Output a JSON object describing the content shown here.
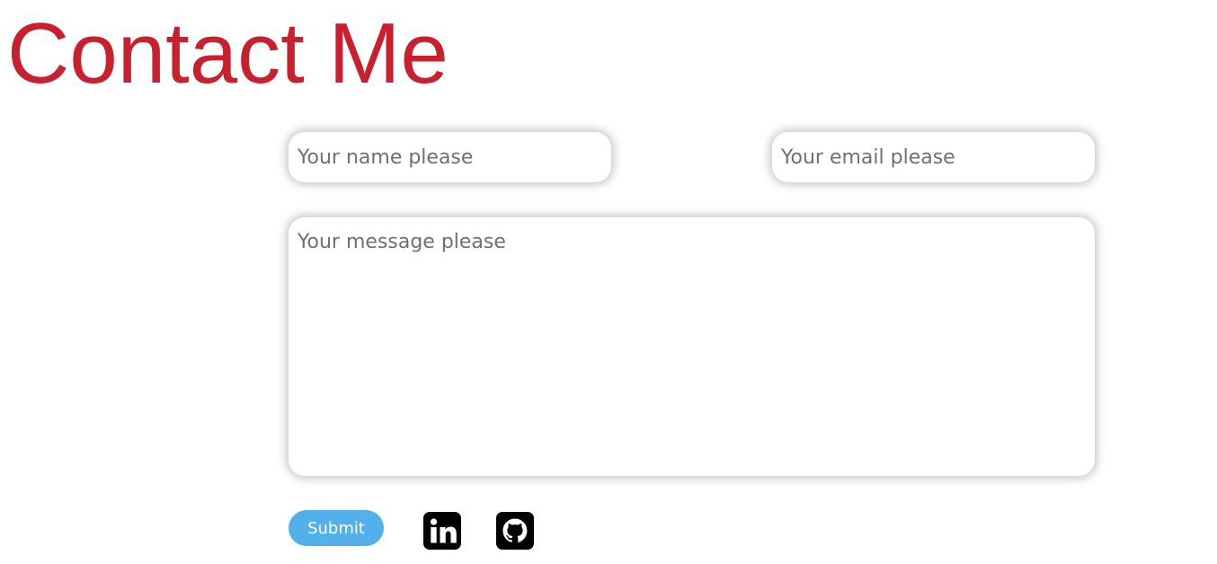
{
  "header": {
    "title": "Contact Me"
  },
  "form": {
    "name_placeholder": "Your name please",
    "email_placeholder": "Your email please",
    "message_placeholder": "Your message please",
    "submit_label": "Submit"
  },
  "social": [
    {
      "icon": "linkedin-icon",
      "color": "#000000"
    },
    {
      "icon": "github-icon",
      "color": "#000000"
    }
  ],
  "colors": {
    "title": "#c8202f",
    "submit_button": "#52b1ea",
    "placeholder": "#707070"
  }
}
